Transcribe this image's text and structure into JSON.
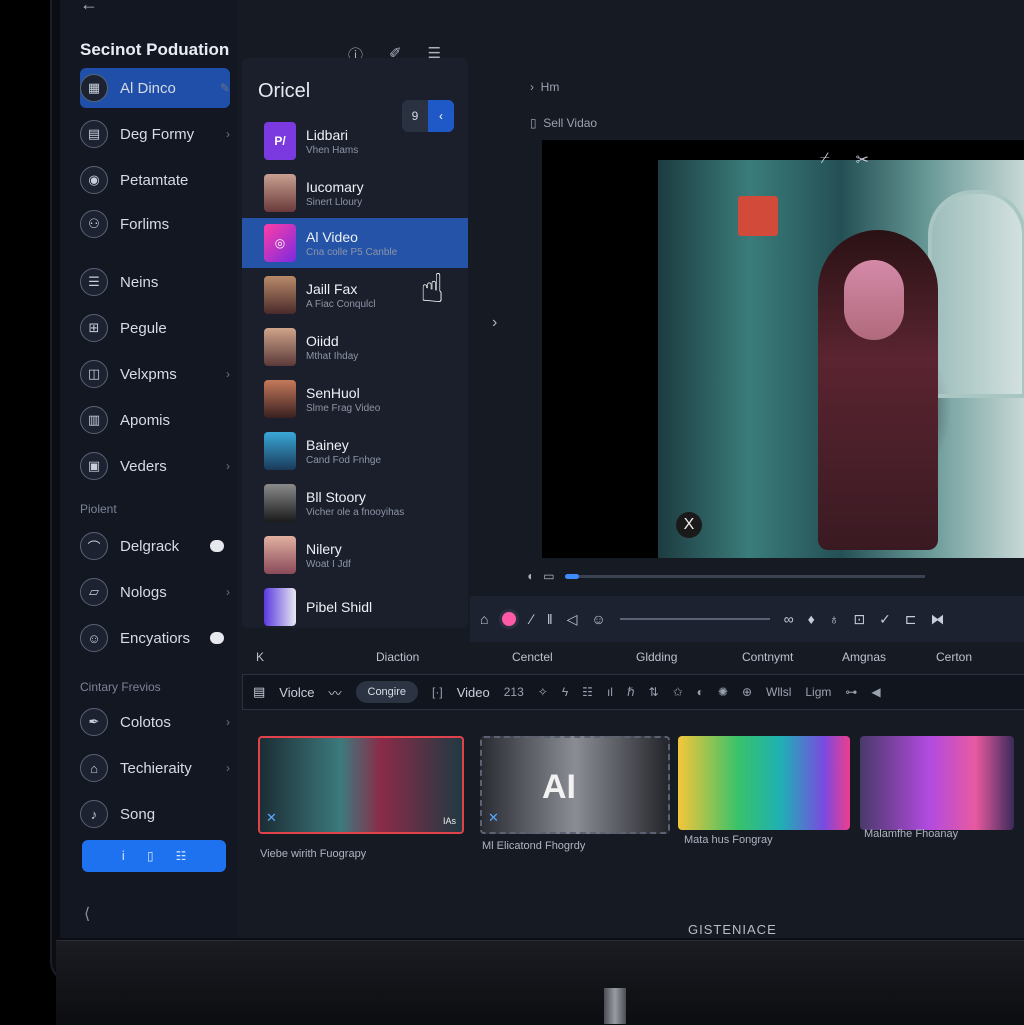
{
  "brand": "GISTENIACE",
  "sidebar": {
    "title": "Secinot Poduation",
    "items": [
      {
        "label": "Al Dinco",
        "icon": "grid-icon"
      },
      {
        "label": "Deg Formy",
        "icon": "document-icon"
      },
      {
        "label": "Petamtate",
        "icon": "palette-icon"
      },
      {
        "label": "Forlims",
        "icon": "people-icon"
      },
      {
        "label": "Neins",
        "icon": "list-icon"
      },
      {
        "label": "Pegule",
        "icon": "table-icon"
      },
      {
        "label": "Velxpms",
        "icon": "panel-icon"
      },
      {
        "label": "Apomis",
        "icon": "book-icon"
      },
      {
        "label": "Veders",
        "icon": "film-icon"
      }
    ],
    "section1": "Piolent",
    "items2": [
      {
        "label": "Delgrack",
        "icon": "hat-icon"
      },
      {
        "label": "Nologs",
        "icon": "chart-icon"
      },
      {
        "label": "Encyatiors",
        "icon": "user-icon"
      }
    ],
    "section2": "Cintary Frevios",
    "items3": [
      {
        "label": "Colotos",
        "icon": "pen-icon"
      },
      {
        "label": "Techieraity",
        "icon": "car-icon"
      },
      {
        "label": "Song",
        "icon": "music-icon"
      }
    ]
  },
  "list": {
    "title": "Oricel",
    "toggle_left": "9",
    "toggle_right": "‹",
    "items": [
      {
        "title": "Lidbari",
        "subtitle": "Vhen Hams",
        "thumb": "P/"
      },
      {
        "title": "Iucomary",
        "subtitle": "Sinert Lloury",
        "thumb": ""
      },
      {
        "title": "Al Video",
        "subtitle": "Cna colle P5 Canble",
        "thumb": ""
      },
      {
        "title": "Jaill Fax",
        "subtitle": "A Fiac Conqulcl",
        "thumb": ""
      },
      {
        "title": "Oiidd",
        "subtitle": "Mthat Ihday",
        "thumb": ""
      },
      {
        "title": "SenHuol",
        "subtitle": "Slme Frag Video",
        "thumb": ""
      },
      {
        "title": "Bainey",
        "subtitle": "Cand Fod Fnhge",
        "thumb": ""
      },
      {
        "title": "Bll Stoory",
        "subtitle": "Vicher ole a fnooyihas",
        "thumb": ""
      },
      {
        "title": "Nilery",
        "subtitle": "Woat I Jdf",
        "thumb": ""
      },
      {
        "title": "Pibel Shidl",
        "subtitle": "",
        "thumb": ""
      }
    ]
  },
  "preview": {
    "header1": "Hm",
    "header2": "Sell Vidao",
    "close": "X"
  },
  "timeline": {
    "labels": [
      "Diaction",
      "Cenctel",
      "Gldding",
      "Contnymt",
      "Amgnas",
      "Certon"
    ],
    "tab_label": "Violce",
    "pill": "Congire",
    "video_label": "Video",
    "count": "213",
    "right_labels": [
      "Wllsl",
      "Ligm"
    ]
  },
  "clips": [
    {
      "label": "Viebe wirith Fuograpy"
    },
    {
      "label": "Ml Elicatond Fhogrdy"
    },
    {
      "label": "Mata hus Fongray"
    },
    {
      "label": "Malamfhe Fhoanay"
    }
  ],
  "clip2_overlay": "AI",
  "clip1_badge": "IAs"
}
